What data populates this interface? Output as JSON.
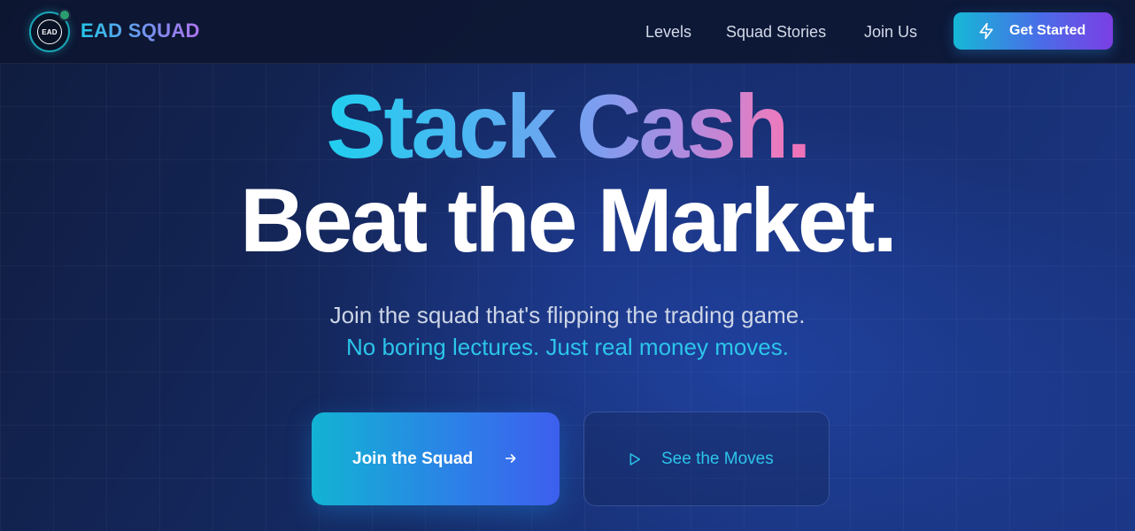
{
  "nav": {
    "logo_text": "EAD",
    "brand": "EAD SQUAD",
    "links": [
      "Levels",
      "Squad Stories",
      "Join Us"
    ],
    "cta_label": "Get Started"
  },
  "hero": {
    "headline_line1": "Stack Cash.",
    "headline_line2": "Beat the Market.",
    "subtitle_line1": "Join the squad that's flipping the trading game.",
    "subtitle_line2": "No boring lectures. Just real money moves."
  },
  "actions": {
    "primary_label": "Join the Squad",
    "secondary_label": "See the Moves"
  },
  "colors": {
    "accent_cyan": "#2cc5ea",
    "accent_purple": "#7b3fe4",
    "accent_pink": "#ef6fb5",
    "background": "#152a63"
  },
  "icons": {
    "cta": "lightning-bolt-icon",
    "primary": "arrow-right-icon",
    "secondary": "play-icon"
  }
}
